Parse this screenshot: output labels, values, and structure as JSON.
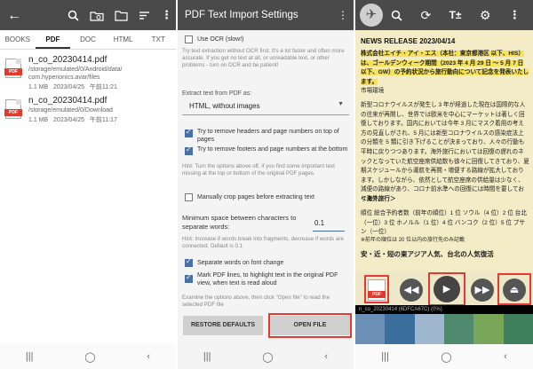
{
  "panel1": {
    "tabs": [
      "BOOKS",
      "PDF",
      "DOC",
      "HTML",
      "TXT"
    ],
    "active_tab": "PDF",
    "files": [
      {
        "name": "n_co_20230414.pdf",
        "path_line1": "/storage/emulated/0/Android/data/",
        "path_line2": "com.hyperionics.avar/files",
        "size": "1.1 MB",
        "date": "2023/04/25",
        "time": "午前11:21"
      },
      {
        "name": "n_co_20230414.pdf",
        "path_line1": "/storage/emulated/0/Download",
        "path_line2": "",
        "size": "1.1 MB",
        "date": "2023/04/25",
        "time": "午前11:17"
      }
    ],
    "pdf_icon_label": "PDF"
  },
  "panel2": {
    "title": "PDF Text Import Settings",
    "use_ocr_label": "Use OCR (slow!)",
    "use_ocr_checked": false,
    "ocr_hint": "Try text extraction without OCR first. It's a lot faster and often more accurate. If you get no text at all, or unreadable text, or other problems - turn on OCR and be patient!",
    "extract_label": "Extract text from PDF as:",
    "extract_value": "HTML, without images",
    "remove_headers_label": "Try to remove headers and page numbers on top of pages",
    "remove_headers_checked": true,
    "remove_footers_label": "Try to remove footers and page numbers at the bottom",
    "remove_footers_checked": true,
    "remove_hint": "Hint: Turn the options above off, if you find some important text missing at the top or bottom of the original PDF pages.",
    "crop_label": "Manually crop pages before extracting text",
    "crop_checked": false,
    "space_label": "Minimum space between characters to separate words:",
    "space_value": "0.1",
    "space_hint": "Hint: Increase if words break into fragments, decrease if words are connected. Default is 0.1",
    "separate_font_label": "Separate words on font change",
    "separate_font_checked": true,
    "mark_lines_label": "Mark PDF lines, to highlight text in the original PDF view, when text is read aloud",
    "mark_lines_checked": true,
    "examine_hint": "Examine the options above, then click \"Open file\" to read the selected PDF file",
    "restore_button": "RESTORE DEFAULTS",
    "open_button": "OPEN FILE"
  },
  "panel3": {
    "news_title": "NEWS RELEASE 2023/04/14",
    "intro": "株式会社エイチ・アイ・エス（本社：東京都港区 以下、HIS）は、ゴールデンウィーク期間（2023 年 4 月 29 日 ～ 5 月 7 日 以下、GW）の予約状況から旅行動向について記念を発表いたします。",
    "section_market": "市場環境",
    "market_text": "新型コロナウイルスが発生し 3 年が経過した現在は国際的な人の往来が再開し、世界では欧米を中心にマーケットは著しく回復しております。国内においては今年 3 月にマスク着用の考え方の見直しがされ、5 月には新型コロナウイルスの感染症法上の分類を 5 類に引き下げることが決まっており、人々の行動も平時に戻りつつあります。海外旅行においては回復の遅れのネックとなっていた航空座席供給数も徐々に回復してきており、夏期スケジュールから運航を再開・増便する路線が拡大しております。しかしながら、依然として航空座席の供給量は少なく、減便の路線があり、コロナ前水準への回復には時間を要しております。",
    "section_overseas": "＜海外旅行＞",
    "ranking_text": "順位 総合予約者数（前年の順位）1 位 ソウル（4 位）2 位 台北（一位）3 位 ホノルル（1 位）4 位 バンコク（2 位）5 位 プサン（一位）",
    "note_text": "※前年の順位は 20 位以内の旅行先のみ記載",
    "headline_text": "安・近・短の東アジア人気、台北の人気復活",
    "status_text": "n_co_20230414 (6DFCA67C) (0%)",
    "pdf_button_label": "PDF"
  },
  "colors": {
    "topbar": "#4a4a4a",
    "highlight": "#f6e25a",
    "annotation_red": "#e53935",
    "reader_bg": "#f4ecc6"
  }
}
